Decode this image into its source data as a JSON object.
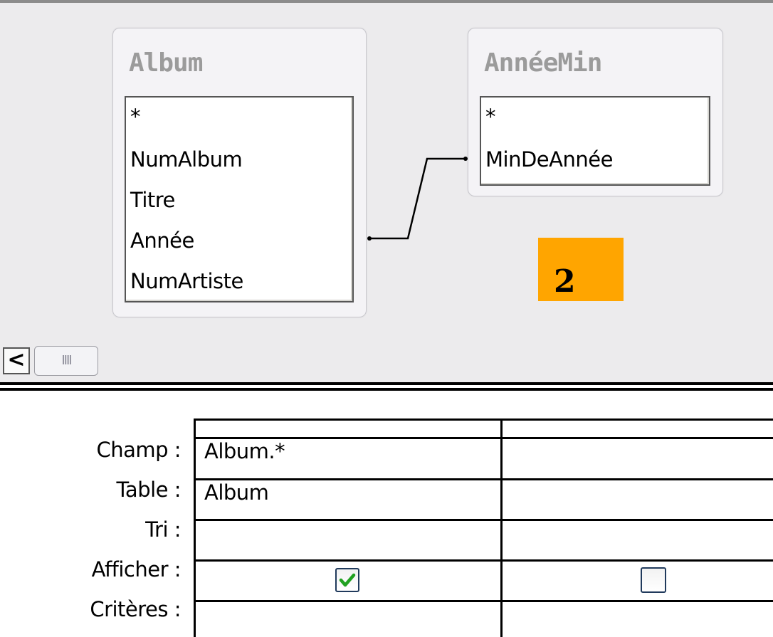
{
  "tables": [
    {
      "title": "Album",
      "fields": [
        "*",
        "NumAlbum",
        "Titre",
        "Année",
        "NumArtiste"
      ]
    },
    {
      "title": "AnnéeMin",
      "fields": [
        "*",
        "MinDeAnnée"
      ]
    }
  ],
  "relationship": {
    "from": "Album.Année",
    "to": "AnnéeMin.MinDeAnnée"
  },
  "badge": {
    "text": "2",
    "color": "#ffa500"
  },
  "scrollbar": {
    "left_arrow": "<",
    "thumb_grip": "IIII"
  },
  "query_grid": {
    "row_labels": [
      "Champ :",
      "Table :",
      "Tri :",
      "Afficher :",
      "Critères :"
    ],
    "columns": [
      {
        "champ": "Album.*",
        "table": "Album",
        "tri": "",
        "afficher_checked": true,
        "criteres": ""
      },
      {
        "champ": "",
        "table": "",
        "tri": "",
        "afficher_checked": false,
        "criteres": ""
      }
    ]
  }
}
